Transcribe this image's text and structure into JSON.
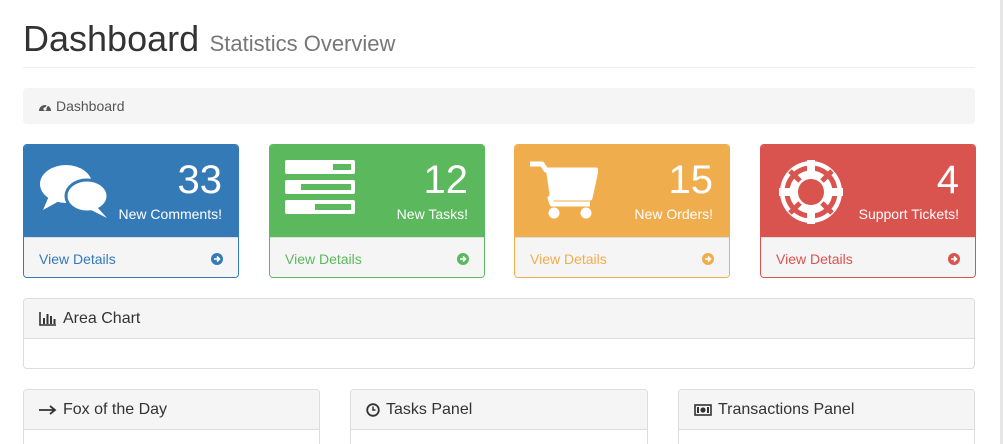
{
  "header": {
    "title": "Dashboard",
    "subtitle": "Statistics Overview"
  },
  "breadcrumb": {
    "icon": "dashboard-icon",
    "label": "Dashboard"
  },
  "cards": [
    {
      "count": "33",
      "label": "New Comments!",
      "link": "View Details",
      "icon": "comments-icon",
      "color": "#337ab7"
    },
    {
      "count": "12",
      "label": "New Tasks!",
      "link": "View Details",
      "icon": "tasks-icon",
      "color": "#5cb85c"
    },
    {
      "count": "15",
      "label": "New Orders!",
      "link": "View Details",
      "icon": "shopping-cart-icon",
      "color": "#f0ad4e"
    },
    {
      "count": "4",
      "label": "Support Tickets!",
      "link": "View Details",
      "icon": "life-ring-icon",
      "color": "#d9534f"
    }
  ],
  "panels": {
    "area_chart": {
      "title": "Area Chart",
      "icon": "bar-chart-icon"
    },
    "fox": {
      "title": "Fox of the Day",
      "icon": "long-arrow-right-icon"
    },
    "tasks": {
      "title": "Tasks Panel",
      "icon": "clock-icon"
    },
    "transactions": {
      "title": "Transactions Panel",
      "icon": "money-icon"
    }
  }
}
